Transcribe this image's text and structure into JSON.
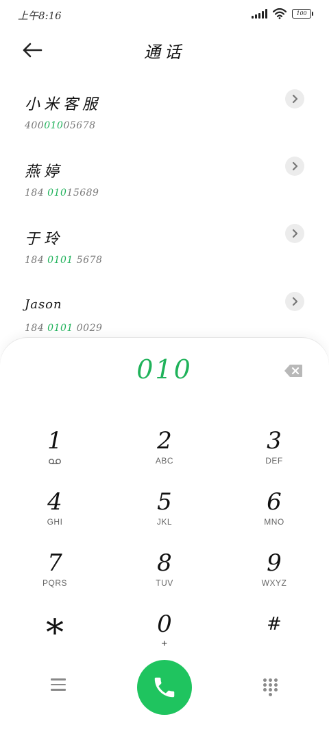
{
  "status": {
    "time": "上午8:16",
    "battery": "100"
  },
  "header": {
    "title": "通话"
  },
  "contacts": [
    {
      "name": "小米客服",
      "number_pre": "400",
      "number_hl": "010",
      "number_post": "05678"
    },
    {
      "name": "燕婷",
      "number_pre": "184 ",
      "number_hl": "010",
      "number_post": "15689"
    },
    {
      "name": "于玲",
      "number_pre": "184 ",
      "number_hl": "0101",
      "number_post": " 5678"
    },
    {
      "name": "Jason",
      "number_pre": "184 ",
      "number_hl": "0101",
      "number_post": " 0029"
    }
  ],
  "dialer": {
    "input": "010",
    "keys": [
      {
        "digit": "1",
        "letters": ""
      },
      {
        "digit": "2",
        "letters": "ABC"
      },
      {
        "digit": "3",
        "letters": "DEF"
      },
      {
        "digit": "4",
        "letters": "GHI"
      },
      {
        "digit": "5",
        "letters": "JKL"
      },
      {
        "digit": "6",
        "letters": "MNO"
      },
      {
        "digit": "7",
        "letters": "PQRS"
      },
      {
        "digit": "8",
        "letters": "TUV"
      },
      {
        "digit": "9",
        "letters": "WXYZ"
      },
      {
        "digit": "*",
        "letters": ""
      },
      {
        "digit": "0",
        "letters": "+"
      },
      {
        "digit": "#",
        "letters": ""
      }
    ]
  },
  "colors": {
    "accent": "#1fc45f",
    "highlight": "#1fb25a"
  },
  "icons": [
    "back-arrow-icon",
    "chevron-right-icon",
    "backspace-icon",
    "voicemail-icon",
    "menu-icon",
    "phone-icon",
    "dialpad-grid-icon",
    "signal-icon",
    "wifi-icon",
    "battery-icon"
  ]
}
